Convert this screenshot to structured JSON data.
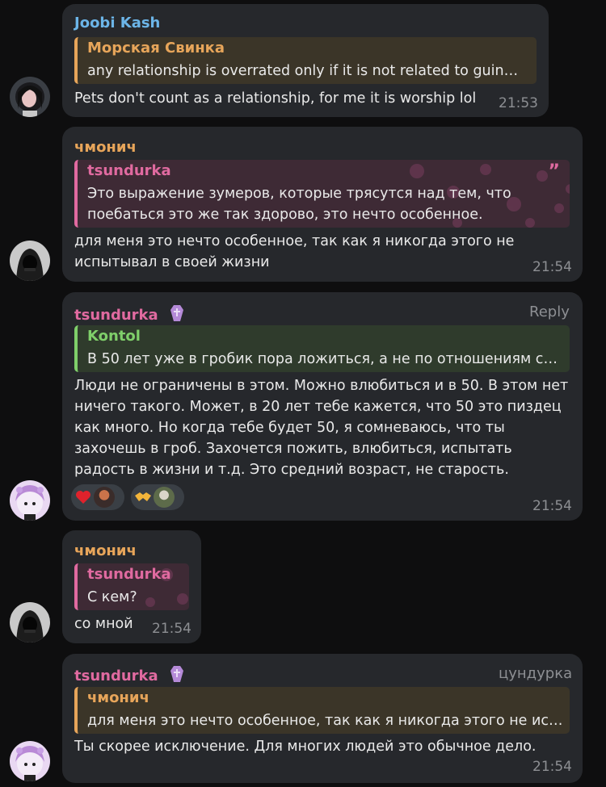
{
  "messages": [
    {
      "sender": "Joobi Kash",
      "quote_name": "Морская Свинка",
      "quote_text": "any relationship is overrated only if it is not related to guin…",
      "text": "Pets don't count as a relationship, for me it is worship lol",
      "time": "21:53"
    },
    {
      "sender": "чмонич",
      "quote_name": "tsundurka",
      "quote_lines": [
        "Это выражение зумеров, которые трясутся над тем, что",
        "поебаться это же так здорово, это нечто особенное."
      ],
      "text_lines": [
        "для меня это нечто особенное, так как я никогда этого не",
        "испытывал в своей жизни"
      ],
      "time": "21:54"
    },
    {
      "sender": "tsundurka",
      "reply_label": "Reply",
      "quote_name": "Kontol",
      "quote_text": "В 50 лет уже в гробик пора ложиться, а не по отношениям ск…",
      "text_lines": [
        "Люди не ограничены в этом. Можно влюбиться и в 50. В этом нет",
        "ничего такого. Может, в 20 лет тебе кажется, что 50 это пиздец",
        "как много. Но когда тебе будет 50, я сомневаюсь, что ты",
        "захочешь в гроб. Захочется пожить, влюбиться, испытать",
        "радость в жизни и т.д. Это средний возраст, не старость."
      ],
      "reactions": [
        {
          "emoji": "❤️",
          "icon": "heart-icon"
        },
        {
          "emoji": "🤝",
          "icon": "handshake-icon"
        }
      ],
      "time": "21:54"
    },
    {
      "sender": "чмонич",
      "quote_name": "tsundurka",
      "quote_text": "С кем?",
      "text": "со мной",
      "time": "21:54"
    },
    {
      "sender": "tsundurka",
      "sender_tag": "цундурка",
      "quote_name": "чмонич",
      "quote_text": "для меня это нечто особенное, так как я никогда этого не ис…",
      "text": "Ты скорее исключение. Для многих людей это обычное дело.",
      "time": "21:54"
    }
  ],
  "colors": {
    "bubble": "#26282c",
    "joobi": "#6cb5e8",
    "chmonich": "#e7a55a",
    "tsundurka": "#e06aa0",
    "kontol": "#7fcf6a",
    "time": "#8d8f93"
  }
}
